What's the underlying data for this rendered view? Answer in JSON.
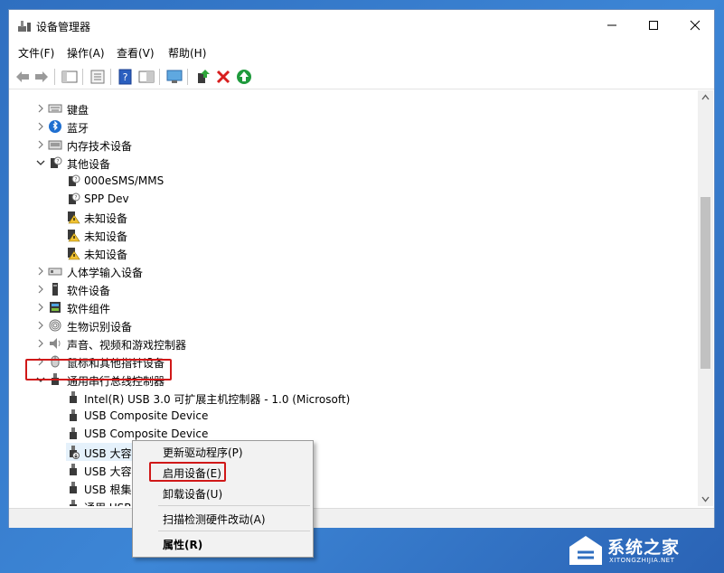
{
  "window": {
    "title": "设备管理器"
  },
  "menu": [
    "文件(F)",
    "操作(A)",
    "查看(V)",
    "帮助(H)"
  ],
  "tree": [
    {
      "label": "键盘",
      "level": 0,
      "expanded": false,
      "icon": "keyboard-icon"
    },
    {
      "label": "蓝牙",
      "level": 0,
      "expanded": false,
      "icon": "bluetooth-icon"
    },
    {
      "label": "内存技术设备",
      "level": 0,
      "expanded": false,
      "icon": "memory-icon"
    },
    {
      "label": "其他设备",
      "level": 0,
      "expanded": true,
      "icon": "unknown-device-icon"
    },
    {
      "label": "000eSMS/MMS",
      "level": 1,
      "icon": "unknown-device-icon"
    },
    {
      "label": "SPP Dev",
      "level": 1,
      "icon": "unknown-device-icon"
    },
    {
      "label": "未知设备",
      "level": 1,
      "icon": "warning-device-icon"
    },
    {
      "label": "未知设备",
      "level": 1,
      "icon": "warning-device-icon"
    },
    {
      "label": "未知设备",
      "level": 1,
      "icon": "warning-device-icon"
    },
    {
      "label": "人体学输入设备",
      "level": 0,
      "expanded": false,
      "icon": "hid-icon"
    },
    {
      "label": "软件设备",
      "level": 0,
      "expanded": false,
      "icon": "software-device-icon"
    },
    {
      "label": "软件组件",
      "level": 0,
      "expanded": false,
      "icon": "software-component-icon"
    },
    {
      "label": "生物识别设备",
      "level": 0,
      "expanded": false,
      "icon": "fingerprint-icon"
    },
    {
      "label": "声音、视频和游戏控制器",
      "level": 0,
      "expanded": false,
      "icon": "speaker-icon"
    },
    {
      "label": "鼠标和其他指针设备",
      "level": 0,
      "expanded": false,
      "icon": "mouse-icon"
    },
    {
      "label": "通用串行总线控制器",
      "level": 0,
      "expanded": true,
      "icon": "usb-icon"
    },
    {
      "label": "Intel(R) USB 3.0 可扩展主机控制器 - 1.0 (Microsoft)",
      "level": 1,
      "icon": "usb-icon"
    },
    {
      "label": "USB Composite Device",
      "level": 1,
      "icon": "usb-icon"
    },
    {
      "label": "USB Composite Device",
      "level": 1,
      "icon": "usb-icon"
    },
    {
      "label": "USB 大容量存储设备",
      "level": 1,
      "icon": "usb-disabled-icon",
      "selected": true
    },
    {
      "label": "USB 大容",
      "level": 1,
      "icon": "usb-icon"
    },
    {
      "label": "USB 根集",
      "level": 1,
      "icon": "usb-icon"
    },
    {
      "label": "通用 USB",
      "level": 1,
      "icon": "usb-icon"
    }
  ],
  "context_menu": {
    "update_driver": "更新驱动程序(P)",
    "enable_device": "启用设备(E)",
    "uninstall_device": "卸载设备(U)",
    "scan_hardware": "扫描检测硬件改动(A)",
    "properties": "属性(R)"
  },
  "watermark": {
    "text": "系统之家",
    "url": "XITONGZHIJIA.NET"
  },
  "colors": {
    "accent": "#0078d7",
    "highlight": "#d01818",
    "selection": "#e5f1fb"
  }
}
